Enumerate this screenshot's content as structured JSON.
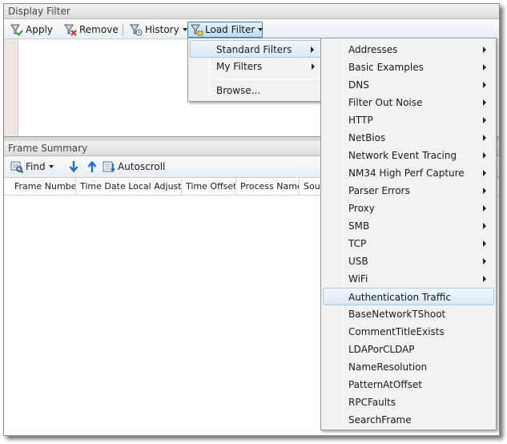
{
  "display_filter": {
    "title": "Display Filter",
    "toolbar": {
      "apply_label": "Apply",
      "remove_label": "Remove",
      "history_label": "History",
      "load_filter_label": "Load Filter"
    }
  },
  "frame_summary": {
    "title": "Frame Summary",
    "toolbar": {
      "find_label": "Find",
      "autoscroll_label": "Autoscroll"
    },
    "columns": [
      "Frame Number",
      "Time Date Local Adjusted",
      "Time Offset",
      "Process Name",
      "Sou"
    ]
  },
  "load_filter_menu": {
    "items": [
      {
        "label": "Standard Filters",
        "submenu": true
      },
      {
        "label": "My Filters",
        "submenu": true
      },
      {
        "label": "Browse...",
        "submenu": false
      }
    ]
  },
  "standard_filters_menu": {
    "items": [
      {
        "label": "Addresses",
        "submenu": true
      },
      {
        "label": "Basic Examples",
        "submenu": true
      },
      {
        "label": "DNS",
        "submenu": true
      },
      {
        "label": "Filter Out Noise",
        "submenu": true
      },
      {
        "label": "HTTP",
        "submenu": true
      },
      {
        "label": "NetBios",
        "submenu": true
      },
      {
        "label": "Network Event Tracing",
        "submenu": true
      },
      {
        "label": "NM34 High Perf Capture",
        "submenu": true
      },
      {
        "label": "Parser Errors",
        "submenu": true
      },
      {
        "label": "Proxy",
        "submenu": true
      },
      {
        "label": "SMB",
        "submenu": true
      },
      {
        "label": "TCP",
        "submenu": true
      },
      {
        "label": "USB",
        "submenu": true
      },
      {
        "label": "WiFi",
        "submenu": true
      },
      {
        "label": "Authentication Traffic",
        "submenu": false
      },
      {
        "label": "BaseNetworkTShoot",
        "submenu": false
      },
      {
        "label": "CommentTitleExists",
        "submenu": false
      },
      {
        "label": "LDAPorCLDAP",
        "submenu": false
      },
      {
        "label": "NameResolution",
        "submenu": false
      },
      {
        "label": "PatternAtOffset",
        "submenu": false
      },
      {
        "label": "RPCFaults",
        "submenu": false
      },
      {
        "label": "SearchFrame",
        "submenu": false
      }
    ]
  },
  "colors": {
    "menu_highlight": "#dbe9f7",
    "highlight_border": "#a8c8e8",
    "arrow_blue": "#1f6fd1"
  }
}
